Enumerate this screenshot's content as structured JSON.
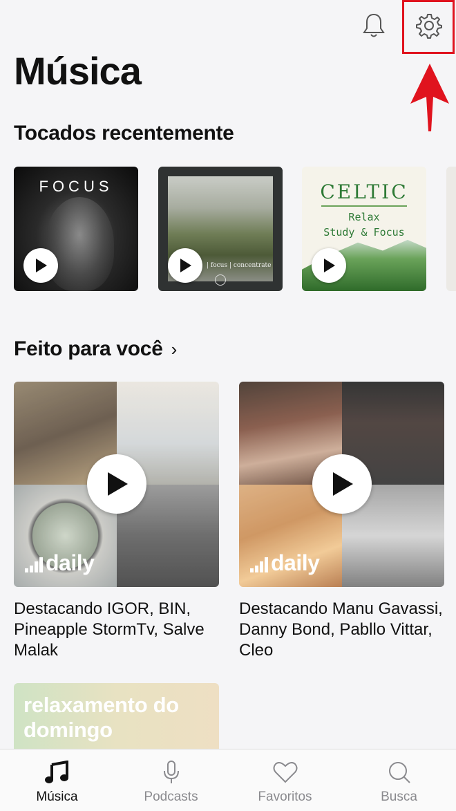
{
  "header": {
    "title": "Música",
    "notifications_icon": "bell-icon",
    "settings_icon": "gear-icon",
    "highlight_color": "#e0131e"
  },
  "recent": {
    "title": "Tocados recentemente",
    "items": [
      {
        "art_text": "FOCUS"
      },
      {
        "art_text": "| focus | concentrate"
      },
      {
        "art_text": "CELTIC",
        "line1": "Relax",
        "line2": "Study & Focus"
      }
    ]
  },
  "made_for_you": {
    "title": "Feito para você",
    "chevron": "›",
    "mixes": [
      {
        "badge": "daily",
        "description": "Destacando IGOR, BIN, Pineapple StormTv, Salve Malak"
      },
      {
        "badge": "daily",
        "description": "Destacando Manu Gavassi, Danny Bond, Pabllo Vittar, Cleo"
      }
    ],
    "next_card_title": "relaxamento do domingo"
  },
  "tabs": [
    {
      "label": "Música",
      "icon": "music-note-icon",
      "active": true
    },
    {
      "label": "Podcasts",
      "icon": "microphone-icon",
      "active": false
    },
    {
      "label": "Favoritos",
      "icon": "heart-icon",
      "active": false
    },
    {
      "label": "Busca",
      "icon": "search-icon",
      "active": false
    }
  ]
}
